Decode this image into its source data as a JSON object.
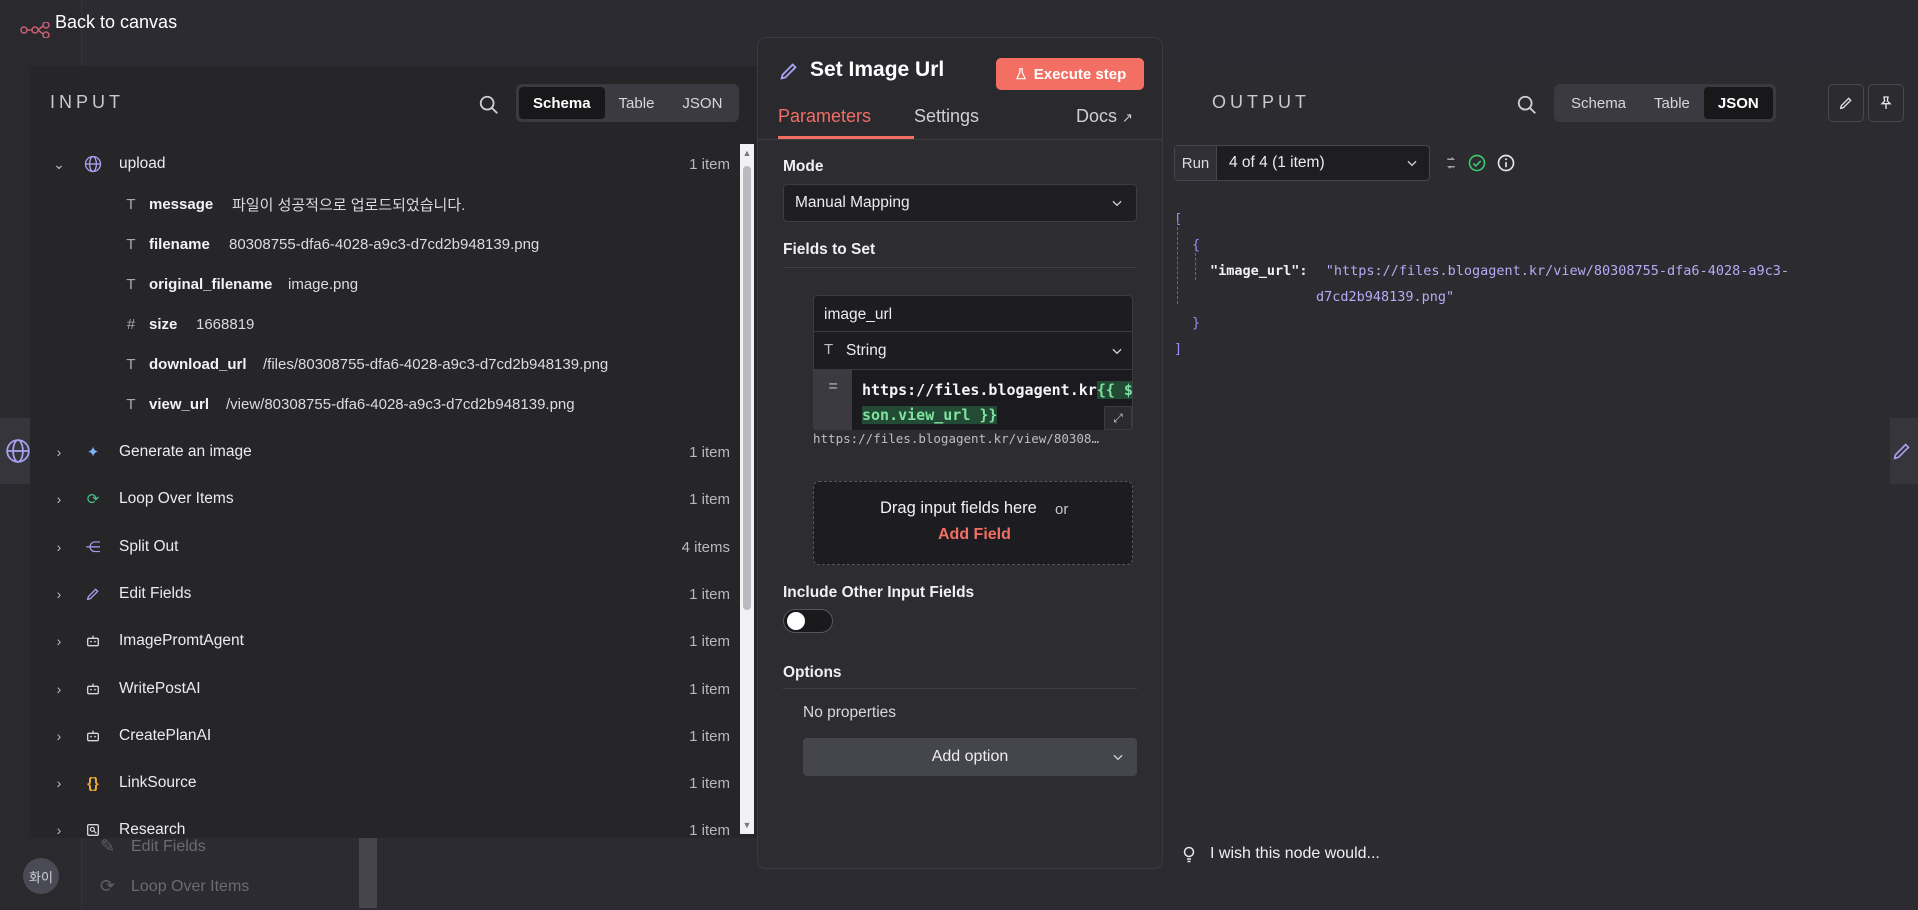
{
  "back_link": "Back to canvas",
  "avatar_text": "화이",
  "bg_ghosts": [
    "Edit Fields",
    "Loop Over Items"
  ],
  "input": {
    "title": "INPUT",
    "tabs": [
      "Schema",
      "Table",
      "JSON"
    ],
    "active_tab": "Schema",
    "upload": {
      "name": "upload",
      "count": "1 item",
      "fields": [
        {
          "type": "T",
          "key": "message",
          "value": "파일이 성공적으로 업로드되었습니다."
        },
        {
          "type": "T",
          "key": "filename",
          "value": "80308755-dfa6-4028-a9c3-d7cd2b948139.png"
        },
        {
          "type": "T",
          "key": "original_filename",
          "value": "image.png"
        },
        {
          "type": "#",
          "key": "size",
          "value": "1668819"
        },
        {
          "type": "T",
          "key": "download_url",
          "value": "/files/80308755-dfa6-4028-a9c3-d7cd2b948139.png"
        },
        {
          "type": "T",
          "key": "view_url",
          "value": "/view/80308755-dfa6-4028-a9c3-d7cd2b948139.png"
        }
      ]
    },
    "nodes": [
      {
        "name": "Generate an image",
        "count": "1 item",
        "icon": "sparkle-icon"
      },
      {
        "name": "Loop Over Items",
        "count": "1 item",
        "icon": "loop-icon"
      },
      {
        "name": "Split Out",
        "count": "4 items",
        "icon": "split-icon"
      },
      {
        "name": "Edit Fields",
        "count": "1 item",
        "icon": "pencil-icon"
      },
      {
        "name": "ImagePromtAgent",
        "count": "1 item",
        "icon": "robot-icon"
      },
      {
        "name": "WritePostAI",
        "count": "1 item",
        "icon": "robot-icon"
      },
      {
        "name": "CreatePlanAI",
        "count": "1 item",
        "icon": "robot-icon"
      },
      {
        "name": "LinkSource",
        "count": "1 item",
        "icon": "braces-icon"
      },
      {
        "name": "Research",
        "count": "1 item",
        "icon": "research-icon"
      }
    ]
  },
  "node": {
    "title": "Set Image Url",
    "execute_label": "Execute step",
    "tabs": {
      "parameters": "Parameters",
      "settings": "Settings",
      "docs": "Docs"
    },
    "mode_label": "Mode",
    "mode_value": "Manual Mapping",
    "fields_label": "Fields to Set",
    "field": {
      "name": "image_url",
      "type": "String",
      "type_symbol": "T",
      "eq": "=",
      "expr_line1_plain": "https://files.blogagent.kr",
      "expr_line1_tpl": "{{ $j",
      "expr_line2_tpl": "son.view_url }}",
      "preview": "https://files.blogagent.kr/view/80308…"
    },
    "drop": {
      "text": "Drag input fields here",
      "or": "or",
      "add": "Add Field"
    },
    "include_label": "Include Other Input Fields",
    "include_on": false,
    "options_label": "Options",
    "no_properties": "No properties",
    "add_option": "Add option"
  },
  "output": {
    "title": "OUTPUT",
    "tabs": [
      "Schema",
      "Table",
      "JSON"
    ],
    "active_tab": "JSON",
    "run_label": "Run",
    "run_value": "4 of 4 (1 item)",
    "json": {
      "open_bracket": "[",
      "open_brace": "{",
      "key": "\"image_url\":",
      "value_line1": "\"https://files.blogagent.kr/view/80308755-dfa6-4028-a9c3-",
      "value_line2": "d7cd2b948139.png\"",
      "close_brace": "}",
      "close_bracket": "]"
    }
  },
  "feedback": "I wish this node would...",
  "colors": {
    "accent": "#f26f64",
    "success": "#3ec46d"
  }
}
